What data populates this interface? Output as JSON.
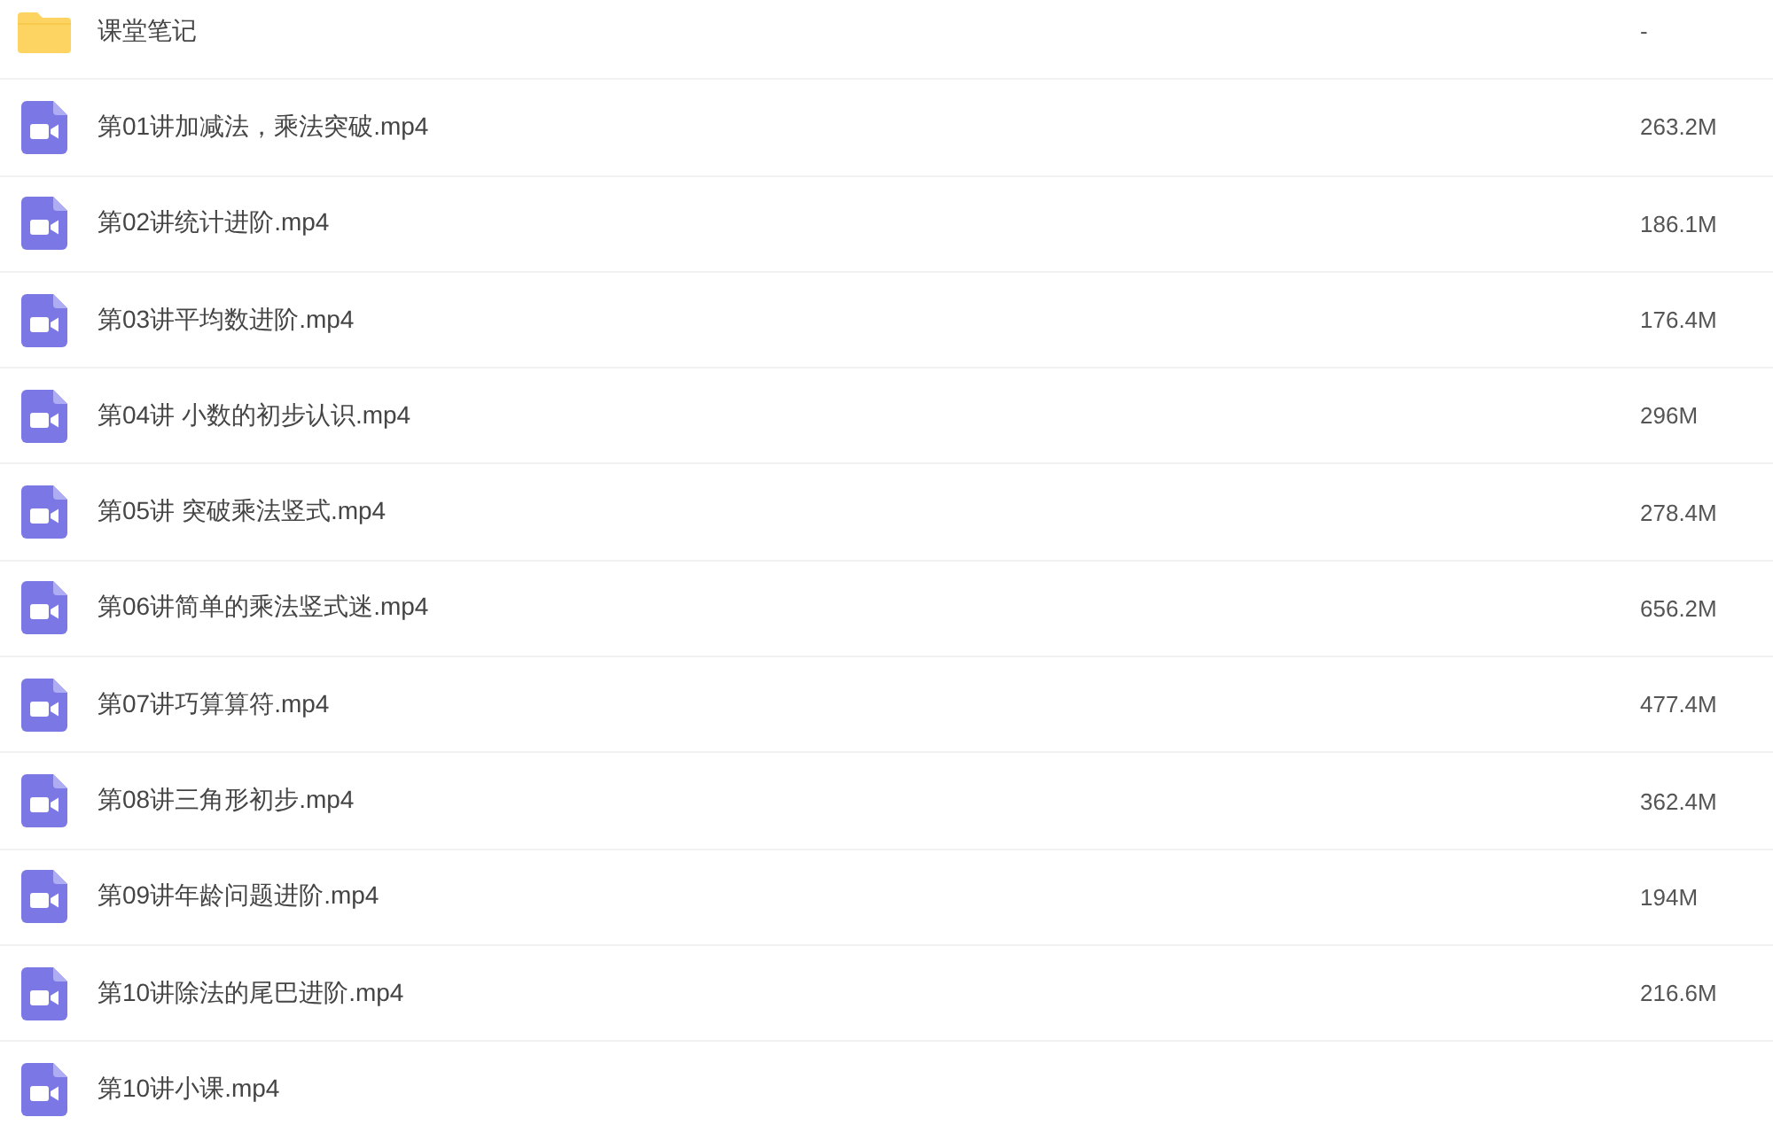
{
  "files": [
    {
      "kind": "folder",
      "name": "课堂笔记",
      "size": "-"
    },
    {
      "kind": "video",
      "name": "第01讲加减法，乘法突破.mp4",
      "size": "263.2M"
    },
    {
      "kind": "video",
      "name": "第02讲统计进阶.mp4",
      "size": "186.1M"
    },
    {
      "kind": "video",
      "name": "第03讲平均数进阶.mp4",
      "size": "176.4M"
    },
    {
      "kind": "video",
      "name": "第04讲 小数的初步认识.mp4",
      "size": "296M"
    },
    {
      "kind": "video",
      "name": "第05讲 突破乘法竖式.mp4",
      "size": "278.4M"
    },
    {
      "kind": "video",
      "name": "第06讲简单的乘法竖式迷.mp4",
      "size": "656.2M"
    },
    {
      "kind": "video",
      "name": "第07讲巧算算符.mp4",
      "size": "477.4M"
    },
    {
      "kind": "video",
      "name": "第08讲三角形初步.mp4",
      "size": "362.4M"
    },
    {
      "kind": "video",
      "name": "第09讲年龄问题进阶.mp4",
      "size": "194M"
    },
    {
      "kind": "video",
      "name": "第10讲除法的尾巴进阶.mp4",
      "size": "216.6M"
    },
    {
      "kind": "video",
      "name": "第10讲小课.mp4"
    }
  ]
}
